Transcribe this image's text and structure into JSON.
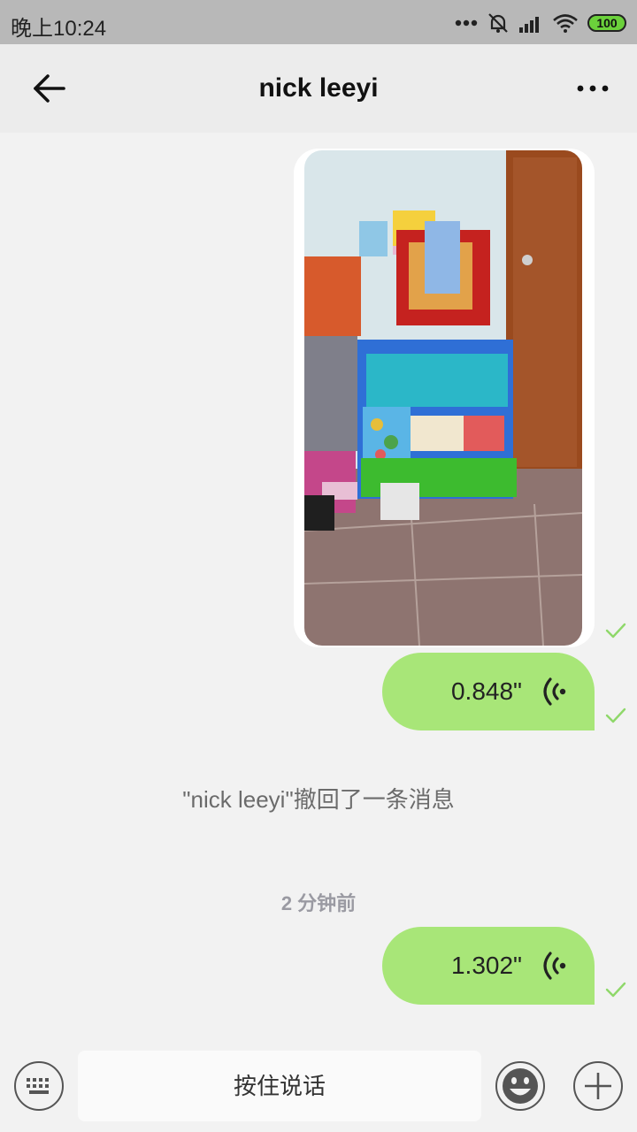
{
  "status_bar": {
    "time": "晚上10:24",
    "battery": "100",
    "icons": [
      "more-dots-icon",
      "mute-icon",
      "signal-icon",
      "wifi-icon",
      "battery-icon"
    ]
  },
  "header": {
    "title": "nick leeyi",
    "back_icon": "back-arrow-icon",
    "more_icon": "more-options-icon"
  },
  "messages": [
    {
      "type": "image",
      "sender": "me",
      "status": "sent"
    },
    {
      "type": "voice",
      "sender": "me",
      "duration": "0.848\"",
      "status": "sent"
    },
    {
      "type": "notice",
      "text": "\"nick leeyi\"撤回了一条消息"
    },
    {
      "type": "timestamp",
      "text": "2 分钟前"
    },
    {
      "type": "voice",
      "sender": "me",
      "duration": "1.302\"",
      "status": "sent"
    }
  ],
  "input_bar": {
    "keyboard_icon": "keyboard-icon",
    "hold_to_talk": "按住说话",
    "emoji_icon": "emoji-icon",
    "plus_icon": "plus-icon"
  },
  "colors": {
    "bubble_me": "#a8e678",
    "check": "#8fd86a",
    "background": "#f2f2f2"
  }
}
